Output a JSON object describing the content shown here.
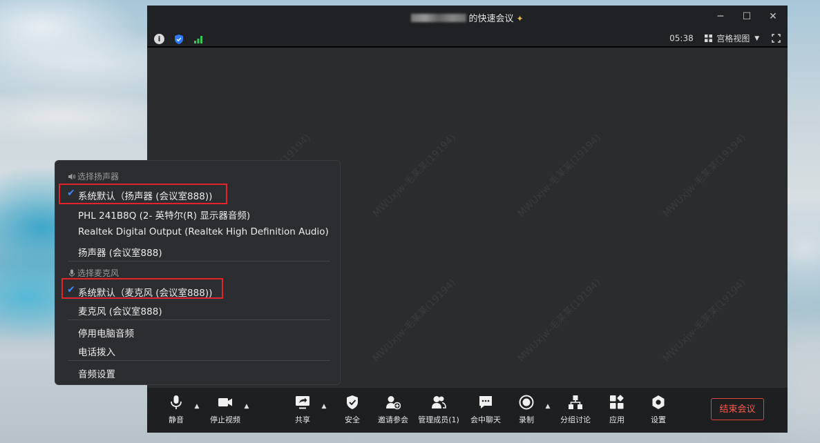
{
  "window": {
    "title_suffix": "的快速会议",
    "time": "05:38",
    "view_mode": "宫格视图",
    "controls": [
      "minimize",
      "maximize",
      "close"
    ]
  },
  "watermark": "MWUxjw-毛某某(19194)",
  "audio_menu": {
    "speaker_header": "选择扬声器",
    "speakers": [
      {
        "label": "系统默认（扬声器 (会议室888))",
        "checked": true
      },
      {
        "label": "PHL 241B8Q (2- 英特尔(R) 显示器音频)",
        "checked": false
      },
      {
        "label": "Realtek Digital Output (Realtek High Definition Audio)",
        "checked": false
      },
      {
        "label": "扬声器 (会议室888)",
        "checked": false
      }
    ],
    "mic_header": "选择麦克风",
    "mics": [
      {
        "label": "系统默认（麦克风 (会议室888))",
        "checked": true
      },
      {
        "label": "麦克风 (会议室888)",
        "checked": false
      }
    ],
    "actions": [
      "停用电脑音频",
      "电话拨入"
    ],
    "settings": "音频设置"
  },
  "toolbar": {
    "mute": "静音",
    "stop_video": "停止视频",
    "share": "共享",
    "security": "安全",
    "invite": "邀请参会",
    "manage": "管理成员(1)",
    "chat": "会中聊天",
    "record": "录制",
    "breakout": "分组讨论",
    "apps": "应用",
    "settings": "设置",
    "end": "结束会议"
  },
  "colors": {
    "accent_blue": "#3d8bff",
    "highlight_red": "#e3252a",
    "end_red": "#ff5a4b",
    "signal_green": "#35c759"
  }
}
